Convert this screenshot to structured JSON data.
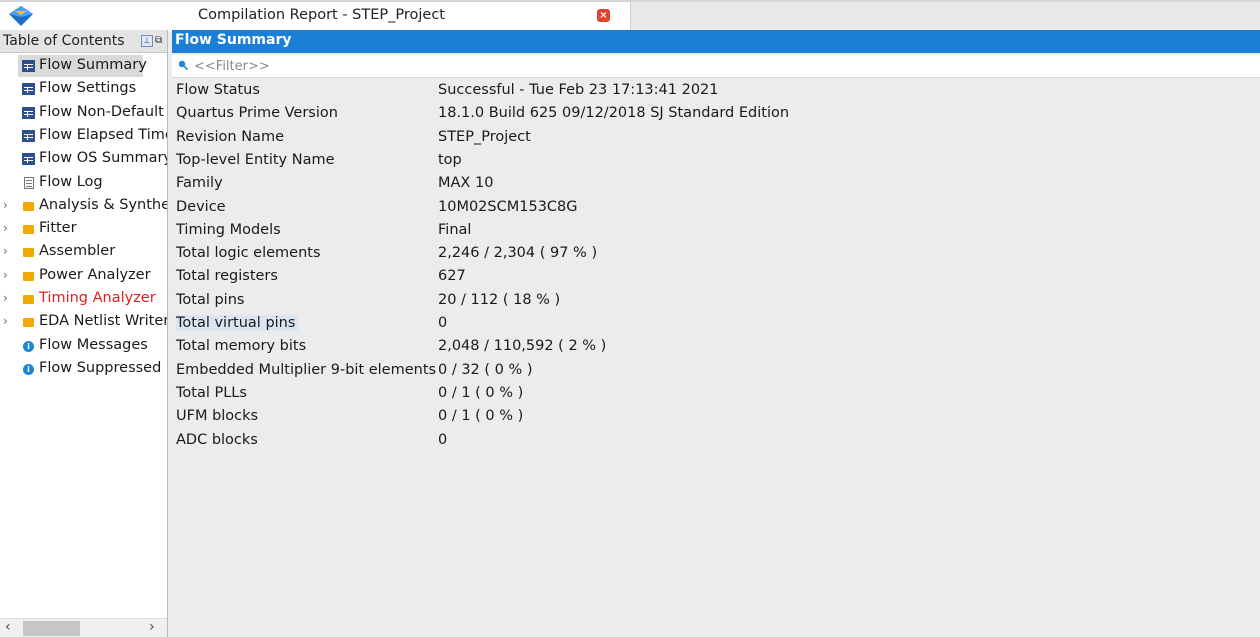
{
  "window": {
    "tab_title": "Compilation Report - STEP_Project",
    "close_glyph": "×"
  },
  "toc": {
    "header": "Table of Contents",
    "items": [
      {
        "label": "Flow Summary",
        "icon": "table-icon",
        "expandable": false,
        "selected": true
      },
      {
        "label": "Flow Settings",
        "icon": "table-icon",
        "expandable": false
      },
      {
        "label": "Flow Non-Default C",
        "icon": "table-icon",
        "expandable": false
      },
      {
        "label": "Flow Elapsed Time",
        "icon": "table-icon",
        "expandable": false
      },
      {
        "label": "Flow OS Summary",
        "icon": "table-icon",
        "expandable": false
      },
      {
        "label": "Flow Log",
        "icon": "log-icon",
        "expandable": false
      },
      {
        "label": "Analysis & Synthes",
        "icon": "folder-icon",
        "expandable": true
      },
      {
        "label": "Fitter",
        "icon": "folder-icon",
        "expandable": true
      },
      {
        "label": "Assembler",
        "icon": "folder-icon",
        "expandable": true
      },
      {
        "label": "Power Analyzer",
        "icon": "folder-icon",
        "expandable": true
      },
      {
        "label": "Timing Analyzer",
        "icon": "folder-icon",
        "expandable": true,
        "color": "#e02020"
      },
      {
        "label": "EDA Netlist Writer",
        "icon": "folder-icon",
        "expandable": true
      },
      {
        "label": "Flow Messages",
        "icon": "info-icon",
        "expandable": false
      },
      {
        "label": "Flow Suppressed M",
        "icon": "info-icon",
        "expandable": false
      }
    ]
  },
  "report": {
    "header": "Flow Summary",
    "filter_placeholder": "<<Filter>>",
    "rows": [
      {
        "key": "Flow Status",
        "value": "Successful - Tue Feb 23 17:13:41 2021"
      },
      {
        "key": "Quartus Prime Version",
        "value": "18.1.0 Build 625 09/12/2018 SJ Standard Edition"
      },
      {
        "key": "Revision Name",
        "value": "STEP_Project"
      },
      {
        "key": "Top-level Entity Name",
        "value": "top"
      },
      {
        "key": "Family",
        "value": "MAX 10"
      },
      {
        "key": "Device",
        "value": "10M02SCM153C8G"
      },
      {
        "key": "Timing Models",
        "value": "Final"
      },
      {
        "key": "Total logic elements",
        "value": "2,246 / 2,304 ( 97 % )"
      },
      {
        "key": "Total registers",
        "value": "627"
      },
      {
        "key": "Total pins",
        "value": "20 / 112 ( 18 % )"
      },
      {
        "key": "Total virtual pins",
        "value": "0",
        "highlight": true
      },
      {
        "key": "Total memory bits",
        "value": "2,048 / 110,592 ( 2 % )"
      },
      {
        "key": "Embedded Multiplier 9-bit elements",
        "value": "0 / 32 ( 0 % )"
      },
      {
        "key": "Total PLLs",
        "value": "0 / 1 ( 0 % )"
      },
      {
        "key": "UFM blocks",
        "value": "0 / 1 ( 0 % )"
      },
      {
        "key": "ADC blocks",
        "value": "0"
      }
    ]
  }
}
